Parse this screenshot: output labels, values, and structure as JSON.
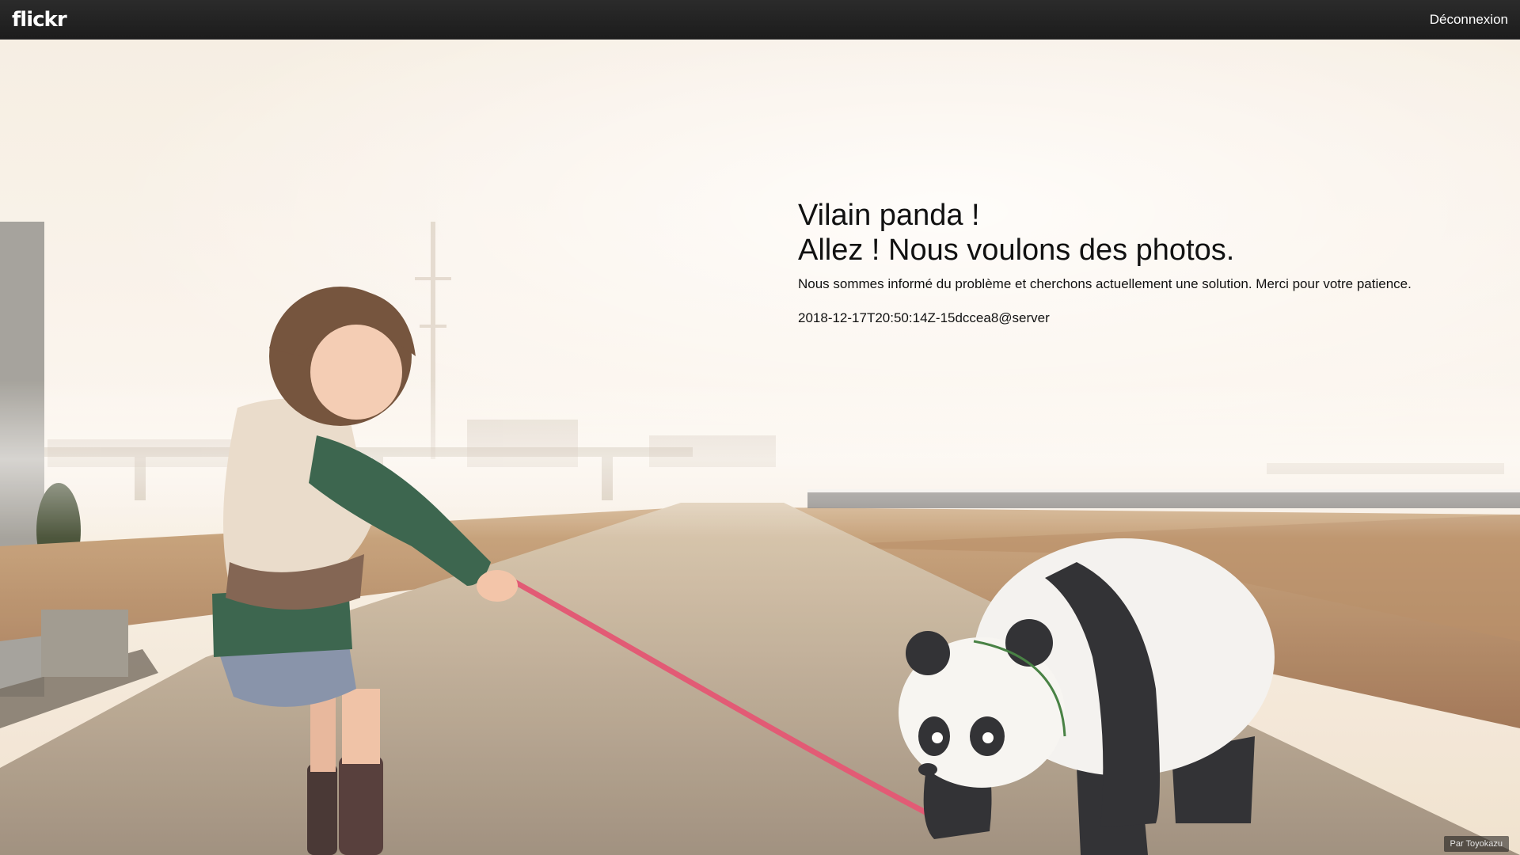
{
  "header": {
    "logo_text": "flickr",
    "signout_label": "Déconnexion"
  },
  "error": {
    "title_line1": "Vilain panda !",
    "title_line2": "Allez ! Nous voulons des photos.",
    "message": "Nous sommes informé du problème et cherchons actuellement une solution. Merci pour votre patience.",
    "code": "2018-12-17T20:50:14Z-15dccea8@server"
  },
  "photo": {
    "credit": "Par Toyokazu"
  },
  "colors": {
    "topbar": "#222222",
    "text": "#111111",
    "leash": "#e0506e"
  }
}
